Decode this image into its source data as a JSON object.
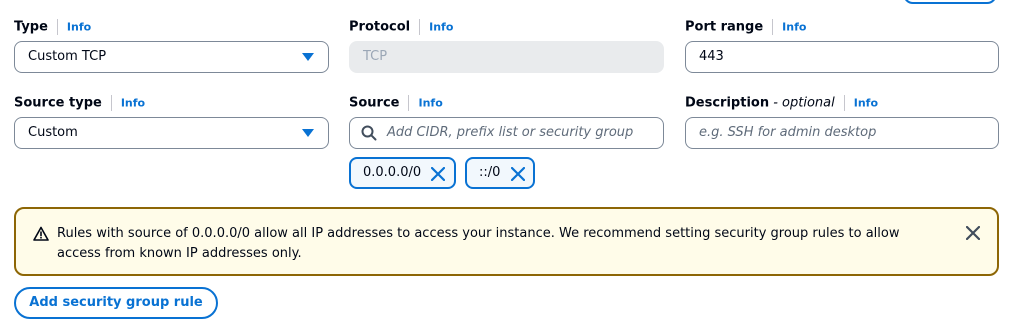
{
  "type_field": {
    "label": "Type",
    "info": "Info",
    "value": "Custom TCP"
  },
  "protocol_field": {
    "label": "Protocol",
    "info": "Info",
    "value": "TCP"
  },
  "port_range_field": {
    "label": "Port range",
    "info": "Info",
    "value": "443"
  },
  "source_type_field": {
    "label": "Source type",
    "info": "Info",
    "value": "Custom"
  },
  "source_field": {
    "label": "Source",
    "info": "Info",
    "placeholder": "Add CIDR, prefix list or security group",
    "tokens": [
      "0.0.0.0/0",
      "::/0"
    ]
  },
  "description_field": {
    "label": "Description",
    "label_suffix": " - optional",
    "info": "Info",
    "placeholder": "e.g. SSH for admin desktop"
  },
  "alert": {
    "message": "Rules with source of 0.0.0.0/0 allow all IP addresses to access your instance. We recommend setting security group rules to allow access from known IP addresses only."
  },
  "add_rule_button": {
    "label": "Add security group rule"
  },
  "colors": {
    "link": "#0972d3",
    "warning_border": "#8d6605",
    "warning_bg": "#fffce9",
    "text": "#000716"
  }
}
